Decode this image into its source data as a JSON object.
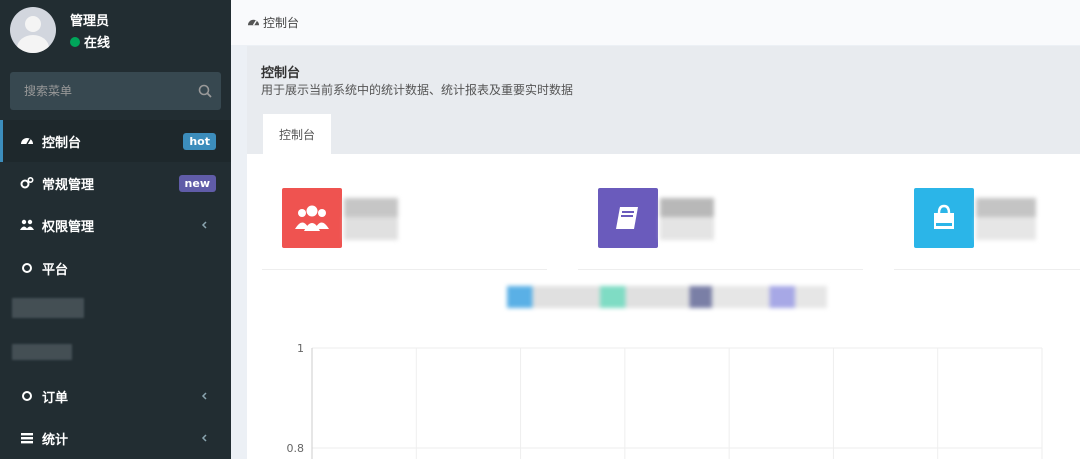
{
  "sidebar": {
    "user": {
      "name": "管理员",
      "status": "在线"
    },
    "search": {
      "placeholder": "搜索菜单"
    },
    "items": [
      {
        "label": "控制台",
        "badge": "hot",
        "icon": "dashboard-icon",
        "active": true
      },
      {
        "label": "常规管理",
        "badge": "new",
        "icon": "cogs-icon"
      },
      {
        "label": "权限管理",
        "icon": "users-icon",
        "has_children": true
      },
      {
        "label": "平台",
        "icon": "circle-icon"
      },
      {
        "label": "订单",
        "icon": "circle-icon",
        "has_children": true
      },
      {
        "label": "统计",
        "icon": "list-icon",
        "has_children": true
      }
    ]
  },
  "breadcrumb": {
    "label": "控制台",
    "icon": "dashboard-icon"
  },
  "header": {
    "title": "控制台",
    "description": "用于展示当前系统中的统计数据、统计报表及重要实时数据"
  },
  "tabs": [
    {
      "label": "控制台"
    }
  ],
  "stats": [
    {
      "icon": "users-icon",
      "color": "#ef5350"
    },
    {
      "icon": "book-icon",
      "color": "#6a5bbc"
    },
    {
      "icon": "shopping-bag-icon",
      "color": "#2bb5e8"
    }
  ],
  "chart_data": {
    "type": "line",
    "y_ticks": [
      "1",
      "0.8"
    ],
    "grid": true
  },
  "colors": {
    "sidebar_bg": "#222d32",
    "accent": "#3c8dbc",
    "badge_hot": "#3c8dbc",
    "badge_new": "#605ca8",
    "online": "#00a65a"
  }
}
